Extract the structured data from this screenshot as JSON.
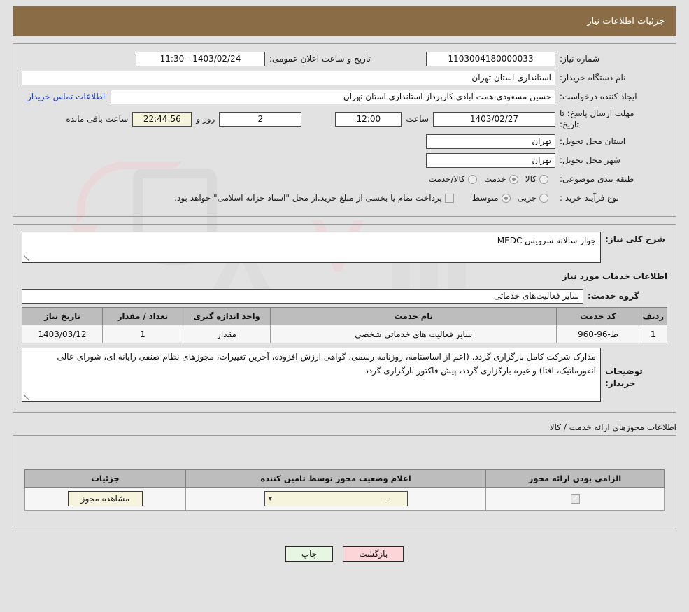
{
  "header": {
    "title": "جزئیات اطلاعات نیاز"
  },
  "info": {
    "need_number_label": "شماره نیاز:",
    "need_number_value": "1103004180000033",
    "public_announce_label": "تاریخ و ساعت اعلان عمومی:",
    "public_announce_value": "1403/02/24 - 11:30",
    "buyer_org_label": "نام دستگاه خریدار:",
    "buyer_org_value": "استانداری استان تهران",
    "creator_label": "ایجاد کننده درخواست:",
    "creator_value": "حسین مسعودی همت آبادی کارپرداز استانداری استان تهران",
    "contact_link": "اطلاعات تماس خریدار",
    "deadline_label": "مهلت ارسال پاسخ: تا\nتاریخ:",
    "deadline_date": "1403/02/27",
    "hour_label": "ساعت",
    "deadline_time": "12:00",
    "days_value": "2",
    "days_label": "روز و",
    "countdown_value": "22:44:56",
    "countdown_label": "ساعت باقی مانده",
    "province_label": "استان محل تحویل:",
    "province_value": "تهران",
    "city_label": "شهر محل تحویل:",
    "city_value": "تهران",
    "category_label": "طبقه بندی موضوعی:",
    "category_options": [
      {
        "label": "کالا",
        "selected": false
      },
      {
        "label": "خدمت",
        "selected": true
      },
      {
        "label": "کالا/خدمت",
        "selected": false
      }
    ],
    "process_label": "نوع فرآیند خرید :",
    "process_options": [
      {
        "label": "جزیی",
        "selected": false
      },
      {
        "label": "متوسط",
        "selected": true
      }
    ],
    "treasury_checked": false,
    "treasury_note": "پرداخت تمام یا بخشی از مبلغ خرید،از محل \"اسناد خزانه اسلامی\" خواهد بود."
  },
  "description": {
    "general_label": "شرح کلی نیاز:",
    "general_value": "جواز سالانه سرویس MEDC",
    "services_section_title": "اطلاعات خدمات مورد نیاز",
    "service_group_label": "گروه خدمت:",
    "service_group_value": "سایر فعالیت‌های خدماتی",
    "buyer_notes_label": "توضیحات خریدار:",
    "buyer_notes_value": "مدارک شرکت کامل بارگزاری گردد. (اعم از اساسنامه، روزنامه رسمی، گواهی ارزش افزوده، آخرین تغییرات، مجوزهای نظام صنفی رایانه ای، شورای عالی انفورماتیک، افتا) و غیره بارگزاری گردد، پیش فاکتور بارگزاری گردد"
  },
  "services_table": {
    "columns": [
      "ردیف",
      "کد خدمت",
      "نام خدمت",
      "واحد اندازه گیری",
      "تعداد / مقدار",
      "تاریخ نیاز"
    ],
    "rows": [
      {
        "index": "1",
        "code": "ط-96-960",
        "name": "سایر فعالیت های خدماتی شخصی",
        "unit": "مقدار",
        "quantity": "1",
        "date": "1403/03/12"
      }
    ]
  },
  "permits": {
    "caption": "اطلاعات مجوزهای ارائه خدمت / کالا",
    "columns": [
      "الزامی بودن ارائه مجوز",
      "اعلام وضعیت مجوز توسط تامین کننده",
      "جزئیات"
    ],
    "rows": [
      {
        "required": true,
        "status_value": "--",
        "details_button": "مشاهده مجوز"
      }
    ]
  },
  "footer": {
    "print_label": "چاپ",
    "back_label": "بازگشت"
  },
  "watermark": {
    "text": "AnaTender.net"
  },
  "colors": {
    "header_bg": "#8a6d47",
    "page_bg": "#e2e2e2",
    "link": "#1f3fd0",
    "cream_field": "#f7f4dd",
    "print_btn": "#e6f6e2",
    "back_btn": "#fbd5d8",
    "table_header": "#bdbdbd"
  }
}
